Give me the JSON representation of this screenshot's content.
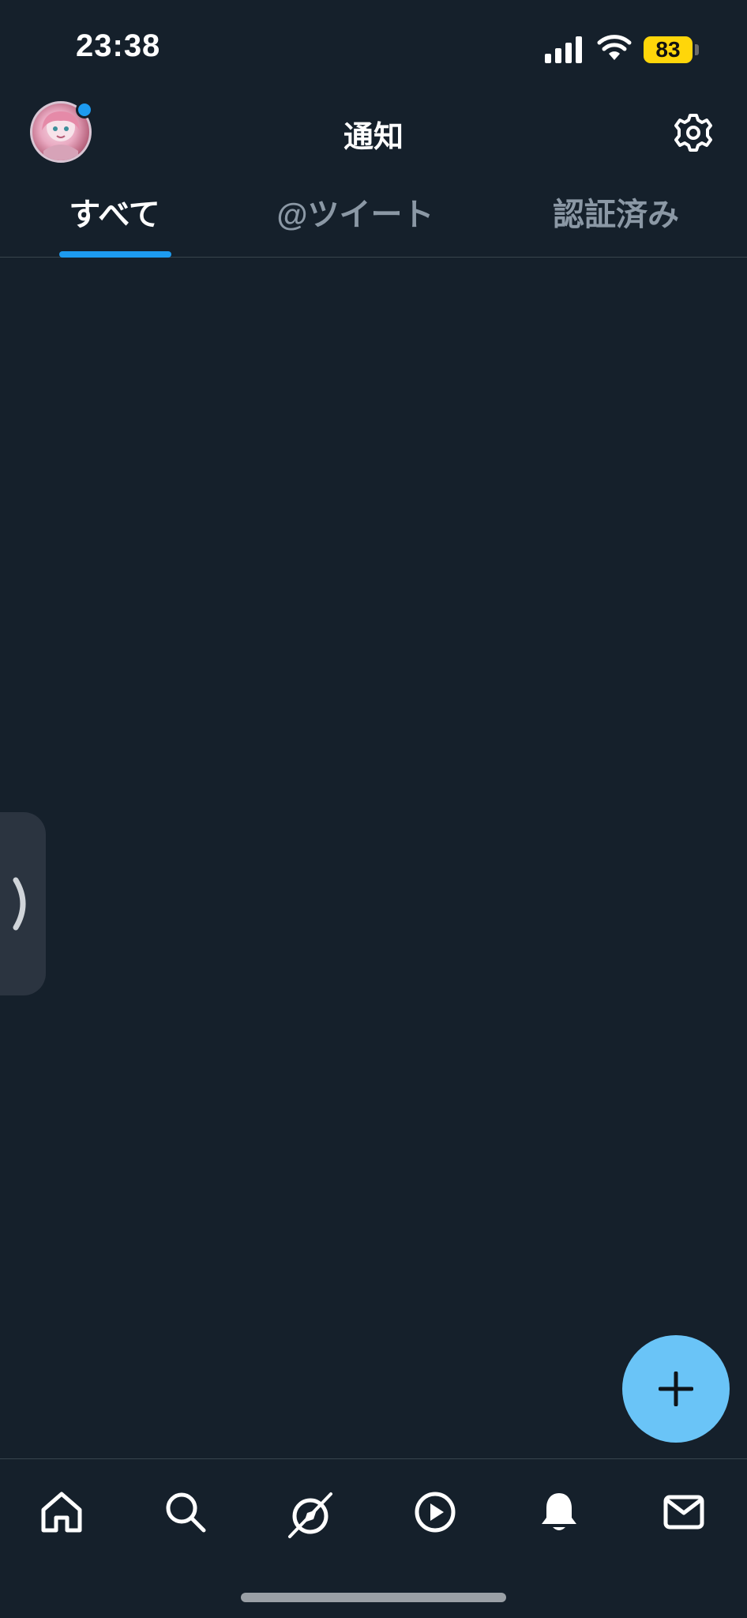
{
  "status_bar": {
    "time": "23:38",
    "battery": "83",
    "battery_color": "#ffd60a",
    "icons": [
      "cellular-signal-icon",
      "wifi-icon",
      "battery-icon"
    ]
  },
  "header": {
    "title": "通知",
    "avatar_icon": "avatar",
    "settings_icon": "gear-icon"
  },
  "tabs": [
    {
      "label": "すべて",
      "active": true
    },
    {
      "label": "@ツイート",
      "active": false
    },
    {
      "label": "認証済み",
      "active": false
    }
  ],
  "side_handle": {
    "glyph": "❯",
    "icon": "chevron-right-icon"
  },
  "fab": {
    "icon": "plus-icon",
    "color": "#6ac4f7"
  },
  "bottom_nav": [
    {
      "name": "home",
      "icon": "home-icon"
    },
    {
      "name": "search",
      "icon": "search-icon"
    },
    {
      "name": "explore",
      "icon": "compass-slash-icon"
    },
    {
      "name": "video",
      "icon": "play-circle-icon"
    },
    {
      "name": "notifications",
      "icon": "bell-icon",
      "active": true
    },
    {
      "name": "messages",
      "icon": "mail-icon"
    }
  ],
  "theme": {
    "background": "#15202b",
    "accent": "#1d9bf0",
    "muted_text": "#8b98a5",
    "divider": "#38444d"
  }
}
